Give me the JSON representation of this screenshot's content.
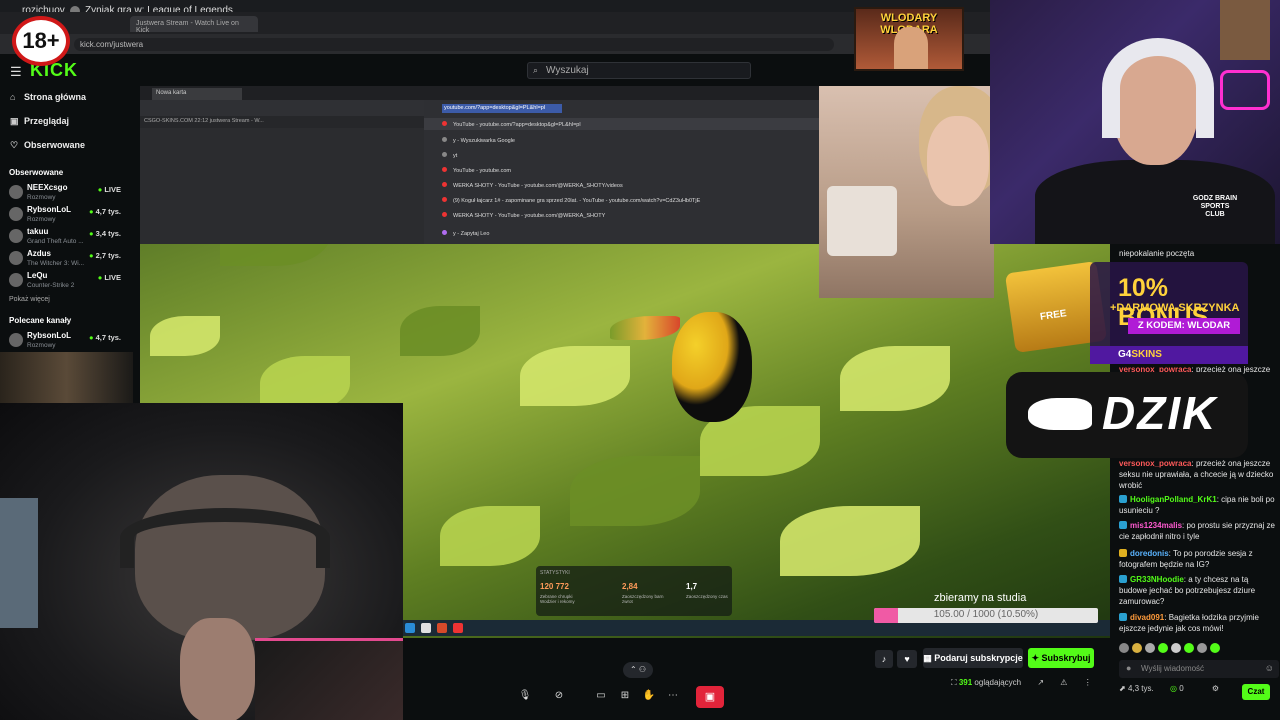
{
  "system": {
    "user": "rozichuov",
    "window_title": "Zyniak gra w: League of Legends"
  },
  "browser": {
    "tab_title": "Justwera Stream - Watch Live on Kick",
    "url": "kick.com/justwera"
  },
  "age_badge": "18+",
  "kick": {
    "logo": "KICK",
    "search_placeholder": "Wyszukaj",
    "nav": [
      {
        "label": "Strona główna",
        "icon": "home-icon"
      },
      {
        "label": "Przeglądaj",
        "icon": "browse-icon"
      },
      {
        "label": "Obserwowane",
        "icon": "heart-icon"
      }
    ],
    "followed_heading": "Obserwowane",
    "followed": [
      {
        "name": "NEEXcsgo",
        "game": "Rozmowy",
        "viewers": "LIVE"
      },
      {
        "name": "RybsonLoL",
        "game": "Rozmowy",
        "viewers": "4,7 tys."
      },
      {
        "name": "takuu",
        "game": "Grand Theft Auto ...",
        "viewers": "3,4 tys."
      },
      {
        "name": "Azdus",
        "game": "The Witcher 3: Wi...",
        "viewers": "2,7 tys."
      },
      {
        "name": "LeQu",
        "game": "Counter-Strike 2",
        "viewers": "LIVE"
      }
    ],
    "show_more": "Pokaż więcej",
    "recommended_heading": "Polecane kanały",
    "recommended": [
      {
        "name": "RybsonLoL",
        "game": "Rozmowy",
        "viewers": "4,7 tys."
      }
    ]
  },
  "share": {
    "tab": "Nowa karta",
    "bookmarks": "CSGO-SKINS.COM   22:12   justwera Stream - W...",
    "address": "youtube.com/?app=desktop&gl=PL&hl=pl",
    "suggestions": [
      "YouTube - youtube.com/?app=desktop&gl=PL&hl=pl",
      "y - Wyszukiwarka Google",
      "yt",
      "YouTube - youtube.com",
      "WERKA SHOTY - YouTube - youtube.com/@WERKA_SHOTY/videos",
      "(9) Koguł łajcarz 1# - zapominane gra sprzed 20lat. - YouTube - youtube.com/watch?v=CdZ3uHb0TjE",
      "WERKA SHOTY - YouTube - youtube.com/@WERKA_SHOTY",
      "y - Zapytaj Leo"
    ]
  },
  "stats": {
    "title": "STATYSTYKI",
    "items": [
      {
        "value": "120 772",
        "label": "Zebrane chrupki Wodzier i rekomy"
      },
      {
        "value": "2,84",
        "label": "Zaoszczędzony barn zwrot"
      },
      {
        "value": "1,7",
        "label": "Zaoszczędzony czas"
      }
    ]
  },
  "goal": {
    "title": "zbieramy na studia",
    "text": "105.00 / 1000 (10.50%)",
    "fraction": 0.105
  },
  "banner": {
    "title": "WLODARY WLODARA"
  },
  "promo": {
    "line1": "10% BONUS",
    "line2": "+DARMOWA SKRZYNKA",
    "line3": "Z KODEM: WLODAR",
    "brand_a": "G4",
    "brand_b": "SKINS",
    "chest_label": "FREE"
  },
  "dzik": {
    "name": "DZIK"
  },
  "shirt_text": "GODZ BRAIN SPORTS CLUB",
  "chat": {
    "messages": [
      {
        "user": "",
        "text": "niepokalanie poczęta",
        "color": "#e6e6e6"
      },
      {
        "user": "versonox_powraca",
        "text": "przecież ona jeszcze",
        "color": "#ff5a5a"
      },
      {
        "user": "versonox_powraca",
        "text": "przecież ona jeszcze seksu nie uprawiała, a chcecie ją w dziecko wrobić",
        "color": "#ff5a5a"
      },
      {
        "user": "HooliganPolland_KrK1",
        "text": "cipa nie boli po usunieciu ?",
        "color": "#53fc18"
      },
      {
        "user": "mis1234malis",
        "text": "po prostu sie przyznaj ze cie zapłodnił nitro i tyle",
        "color": "#ff5ad0"
      },
      {
        "user": "doredonis",
        "text": "To po porodzie sesja z fotografem będzie na IG?",
        "color": "#5ab4ff"
      },
      {
        "user": "GR33NHoodie",
        "text": "a ty chcesz na tą budowe jechać bo potrzebujesz dziure zamurowac?",
        "color": "#53fc18"
      },
      {
        "user": "divad091",
        "text": "Bagietka łodzika przyjmie ejszcze jedynie jak cos mówi!",
        "color": "#ff9b3b"
      }
    ],
    "input_placeholder": "Wyślij wiadomość",
    "bottom_count": "4,3 tys.",
    "bottom_points": "0",
    "send_label": "Czat"
  },
  "actions": {
    "gift_label": "Podaruj subskrypcje",
    "sub_label": "Subskrybuj",
    "viewers_count": "391",
    "viewers_label": "oglądających"
  },
  "colors": {
    "kick_green": "#53fc18",
    "end_call": "#e2243a"
  }
}
